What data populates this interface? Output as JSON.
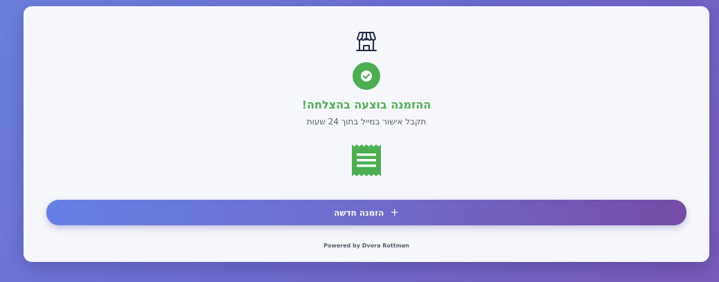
{
  "confirmation": {
    "title": "ההזמנה בוצעה בהצלחה!",
    "subtitle": "תקבל אישור במייל בתוך 24 שעות"
  },
  "actions": {
    "new_order_label": "הזמנה חדשה",
    "new_order_icon": "plus-icon"
  },
  "footer": {
    "powered_by": "Powered by Dvora Rottman"
  },
  "icons": {
    "header": "store-icon",
    "status": "check-circle-icon",
    "receipt": "receipt-icon"
  },
  "colors": {
    "success": "#4caf50",
    "icon_dark": "#1f2a44",
    "button_gradient_start": "#6480e6",
    "button_gradient_end": "#764ca6",
    "card_background": "#f6f7fb"
  }
}
